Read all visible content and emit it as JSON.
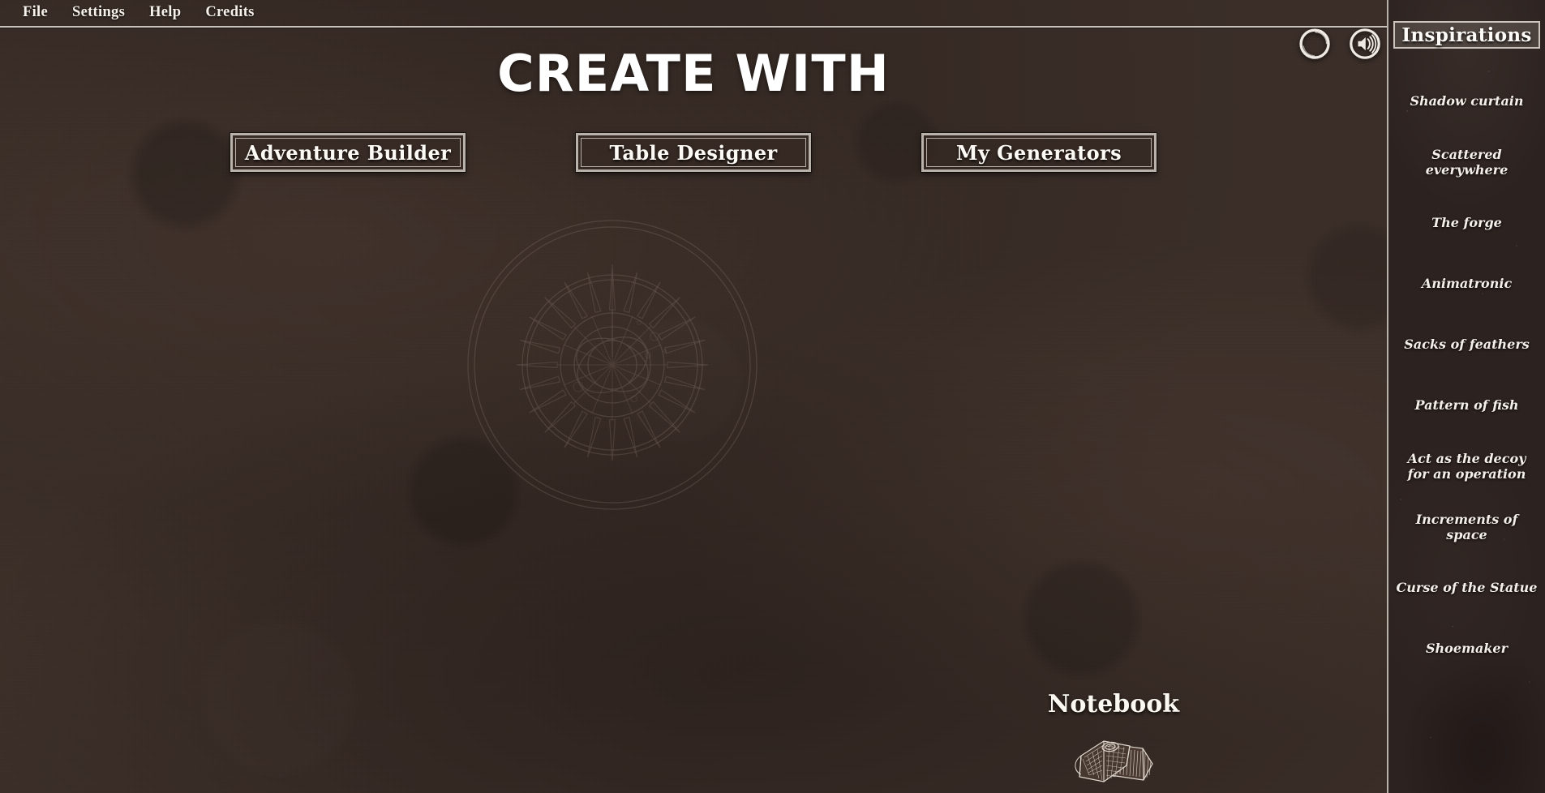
{
  "menubar": {
    "items": [
      {
        "label": "File",
        "name": "menu-file"
      },
      {
        "label": "Settings",
        "name": "menu-settings"
      },
      {
        "label": "Help",
        "name": "menu-help"
      },
      {
        "label": "Credits",
        "name": "menu-credits"
      }
    ]
  },
  "main": {
    "title": "CREATE WITH",
    "buttons": [
      {
        "label": "Adventure Builder",
        "name": "adventure-builder-button"
      },
      {
        "label": "Table Designer",
        "name": "table-designer-button"
      },
      {
        "label": "My Generators",
        "name": "my-generators-button"
      }
    ],
    "watermark_icon": "compass-rose-wheel",
    "notebook": {
      "label": "Notebook",
      "icon": "notebook-books-illustration"
    }
  },
  "top_icons": [
    {
      "name": "ring-circle-icon",
      "icon": "ring-circle"
    },
    {
      "name": "volume-icon",
      "icon": "speaker-volume"
    }
  ],
  "sidebar": {
    "header": "Inspirations",
    "items": [
      {
        "label": "Shadow curtain"
      },
      {
        "label": "Scattered everywhere"
      },
      {
        "label": "The forge"
      },
      {
        "label": "Animatronic"
      },
      {
        "label": "Sacks of feathers"
      },
      {
        "label": "Pattern of fish"
      },
      {
        "label": "Act as the decoy for an operation"
      },
      {
        "label": "Increments of space"
      },
      {
        "label": "Curse of the Statue"
      },
      {
        "label": "Shoemaker"
      }
    ]
  },
  "colors": {
    "background": "#3a2d27",
    "sidebar_background": "#2c2220",
    "text": "#f4efe8",
    "border": "#c9c2ba",
    "title": "#ffffff"
  }
}
